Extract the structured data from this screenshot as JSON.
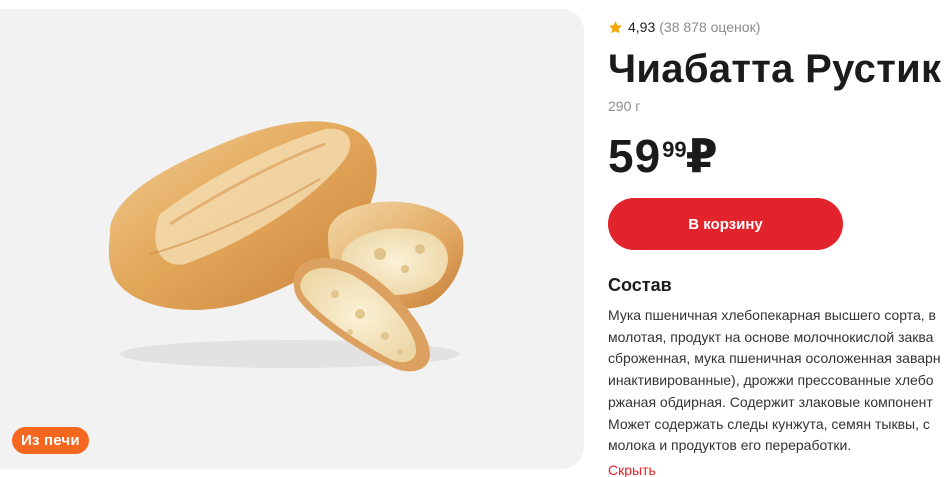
{
  "product": {
    "title": "Чиабатта Рустик",
    "rating_score": "4,93",
    "rating_count": "(38 878 оценок)",
    "weight": "290 г",
    "price_rub": "59",
    "price_kop": "99",
    "currency": "₽",
    "badge": "Из печи",
    "image_icon": "bread-image"
  },
  "actions": {
    "add_to_cart": "В корзину",
    "hide": "Скрыть"
  },
  "composition": {
    "heading": "Состав",
    "lines": [
      "Мука пшеничная хлебопекарная высшего сорта, в",
      "молотая, продукт на основе молочнокислой заква",
      "сброженная, мука пшеничная осоложенная заварн",
      "инактивированные), дрожжи прессованные хлебо",
      "ржаная обдирная. Содержит злаковые компонент",
      "Может содержать следы кунжута, семян тыквы, с",
      "молока и продуктов его переработки."
    ]
  },
  "colors": {
    "accent_red": "#e3232b",
    "badge_orange": "#f5661f",
    "star": "#f6a609",
    "card_bg": "#f2f2f2"
  }
}
